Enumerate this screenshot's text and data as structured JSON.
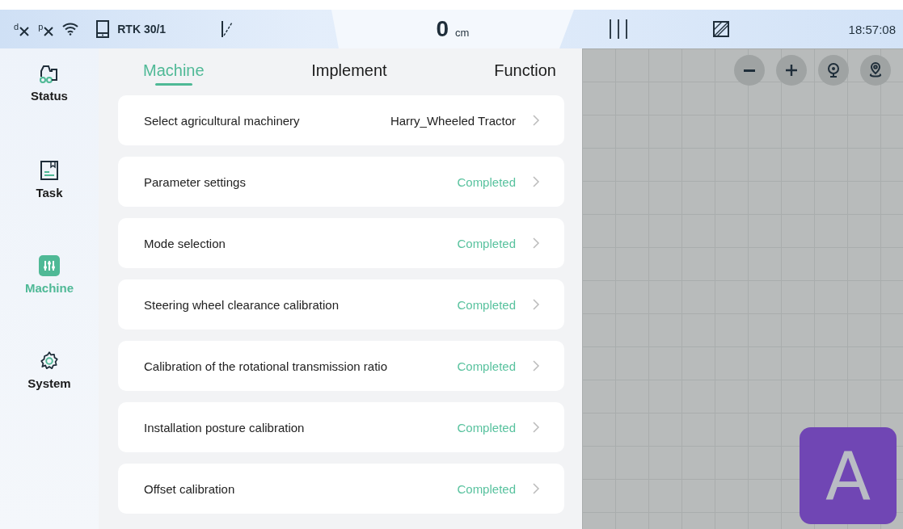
{
  "status_bar": {
    "diff_label": "d",
    "pos_label": "p",
    "rtk": "RTK 30/1",
    "offset_value": "0",
    "offset_unit": "cm",
    "time": "18:57:08"
  },
  "sidebar": {
    "items": [
      {
        "kind": "tractor",
        "label": "Status",
        "selected": false
      },
      {
        "kind": "task",
        "label": "Task",
        "selected": false
      },
      {
        "kind": "machine",
        "label": "Machine",
        "selected": true
      },
      {
        "kind": "system",
        "label": "System",
        "selected": false
      }
    ]
  },
  "tabs": [
    {
      "label": "Machine",
      "selected": true
    },
    {
      "label": "Implement",
      "selected": false
    },
    {
      "label": "Function",
      "selected": false
    }
  ],
  "settings": [
    {
      "label": "Select agricultural machinery",
      "value": "Harry_Wheeled Tractor",
      "kind": "value"
    },
    {
      "label": "Parameter settings",
      "value": "Completed",
      "kind": "status"
    },
    {
      "label": "Mode selection",
      "value": "Completed",
      "kind": "status"
    },
    {
      "label": "Steering wheel clearance calibration",
      "value": "Completed",
      "kind": "status"
    },
    {
      "label": "Calibration of the rotational transmission ratio",
      "value": "Completed",
      "kind": "status"
    },
    {
      "label": "Installation posture calibration",
      "value": "Completed",
      "kind": "status"
    },
    {
      "label": "Offset calibration",
      "value": "Completed",
      "kind": "status"
    }
  ],
  "map": {
    "mode_button": "A"
  }
}
